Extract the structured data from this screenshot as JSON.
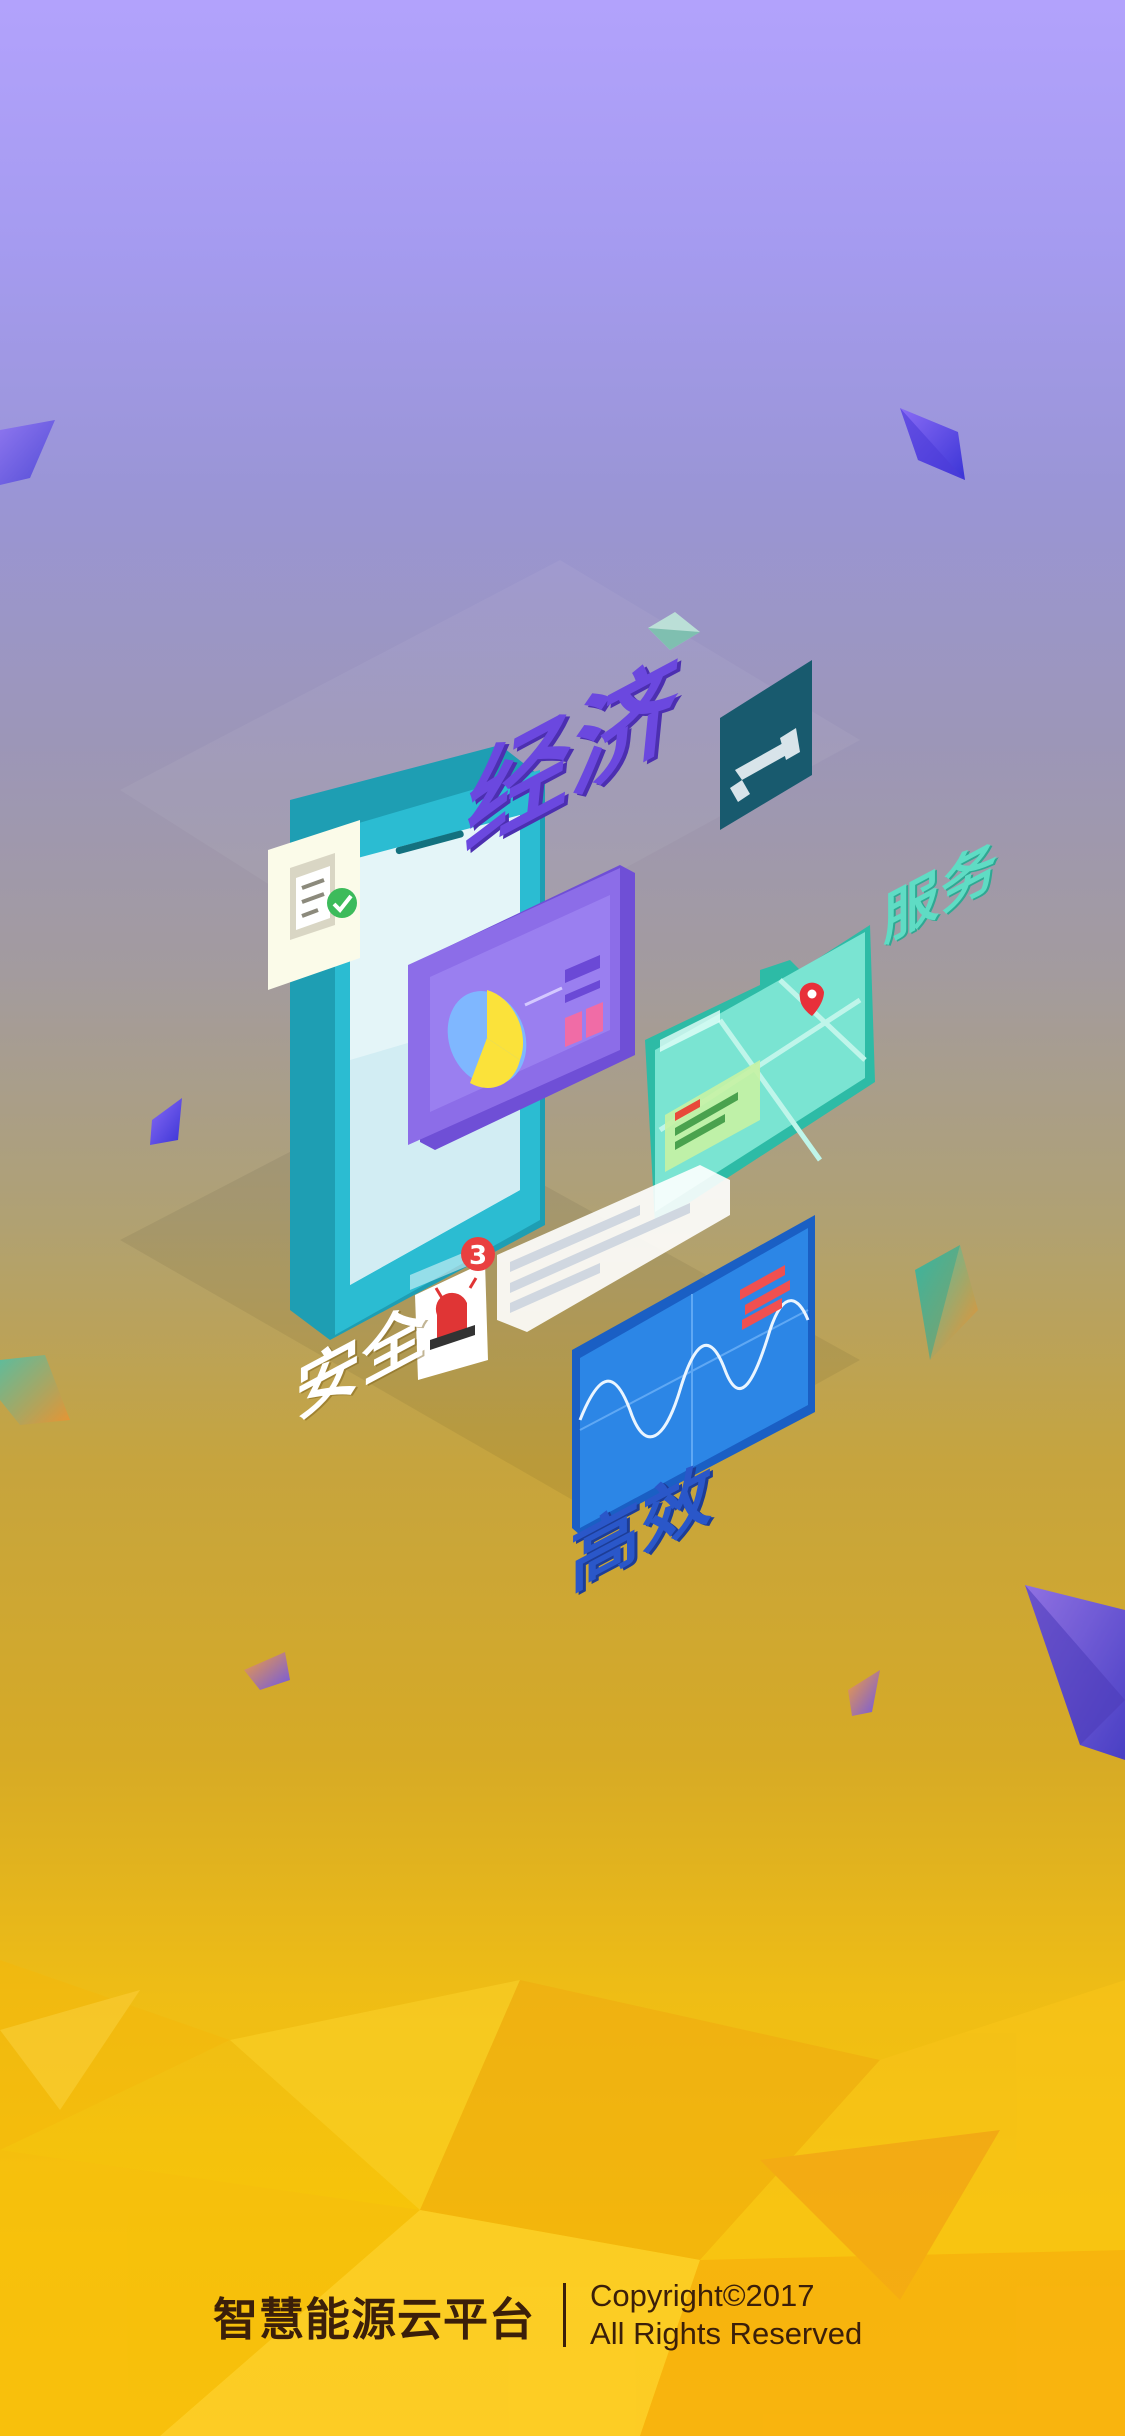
{
  "labels": {
    "economy": "经济",
    "service": "服务",
    "safety": "安全",
    "efficiency": "高效"
  },
  "alert_badge_count": "3",
  "icons": [
    "clipboard-check-icon",
    "pie-chart-icon",
    "security-camera-icon",
    "map-pin-icon",
    "siren-alarm-icon",
    "waveform-monitor-icon"
  ],
  "footer": {
    "brand": "智慧能源云平台",
    "copyright": "Copyright©2017",
    "rights": "All Rights Reserved"
  },
  "colors": {
    "top": "#b2a2fc",
    "bottom": "#fbc30a",
    "economy": "#6b48df",
    "service": "#5fdcc4",
    "efficiency": "#2a57c9",
    "footer_text": "#3b1f0a"
  }
}
